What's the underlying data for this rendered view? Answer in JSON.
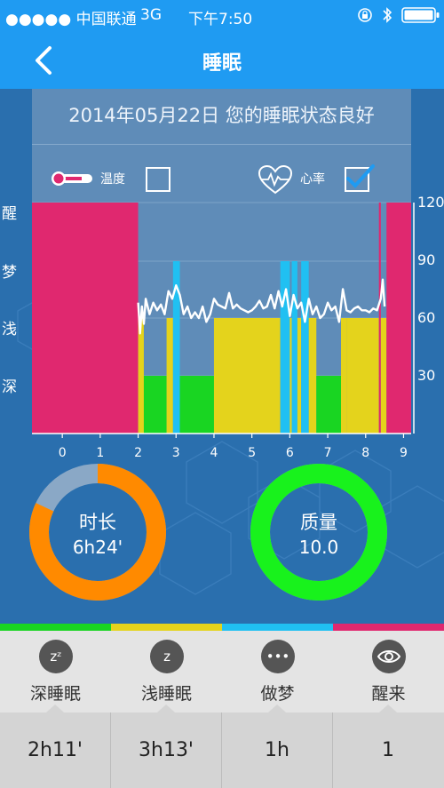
{
  "status": {
    "signal": "●●●●● 中国联通",
    "network": "3G",
    "time": "下午7:50"
  },
  "nav": {
    "title": "睡眠"
  },
  "header": {
    "date_line": "2014年05月22日 您的睡眠状态良好"
  },
  "options": {
    "temperature_label": "温度",
    "temperature_checked": false,
    "heartrate_label": "心率",
    "heartrate_checked": true
  },
  "chart_data": {
    "type": "bar",
    "stages": [
      "醒",
      "梦",
      "浅",
      "深"
    ],
    "x_ticks": [
      0,
      1,
      2,
      3,
      4,
      5,
      6,
      7,
      8,
      9
    ],
    "y_right_ticks": [
      120,
      90,
      60,
      30
    ],
    "xlim": [
      -0.8,
      9.2
    ],
    "stage_colors": {
      "醒": "#e0286f",
      "梦": "#20c0f2",
      "浅": "#e4d31c",
      "深": "#19d522"
    },
    "segments": [
      {
        "stage": "醒",
        "start": -0.8,
        "end": 2.0
      },
      {
        "stage": "浅",
        "start": 2.0,
        "end": 2.15
      },
      {
        "stage": "深",
        "start": 2.15,
        "end": 2.75
      },
      {
        "stage": "浅",
        "start": 2.75,
        "end": 2.92
      },
      {
        "stage": "梦",
        "start": 2.92,
        "end": 3.1
      },
      {
        "stage": "深",
        "start": 3.1,
        "end": 4.0
      },
      {
        "stage": "浅",
        "start": 4.0,
        "end": 5.75
      },
      {
        "stage": "梦",
        "start": 5.75,
        "end": 6.0
      },
      {
        "stage": "浅",
        "start": 6.0,
        "end": 6.05
      },
      {
        "stage": "梦",
        "start": 6.05,
        "end": 6.2
      },
      {
        "stage": "浅",
        "start": 6.2,
        "end": 6.3
      },
      {
        "stage": "梦",
        "start": 6.3,
        "end": 6.5
      },
      {
        "stage": "浅",
        "start": 6.5,
        "end": 6.7
      },
      {
        "stage": "深",
        "start": 6.7,
        "end": 7.35
      },
      {
        "stage": "浅",
        "start": 7.35,
        "end": 7.5
      },
      {
        "stage": "浅",
        "start": 7.5,
        "end": 8.35
      },
      {
        "stage": "醒",
        "start": 8.35,
        "end": 8.4
      },
      {
        "stage": "浅",
        "start": 8.4,
        "end": 8.55
      },
      {
        "stage": "醒",
        "start": 8.55,
        "end": 9.2
      }
    ],
    "heart_rate": {
      "x": [
        2.0,
        2.05,
        2.1,
        2.15,
        2.2,
        2.3,
        2.4,
        2.5,
        2.6,
        2.7,
        2.8,
        2.9,
        3.0,
        3.1,
        3.2,
        3.3,
        3.4,
        3.5,
        3.6,
        3.7,
        3.8,
        3.9,
        4.0,
        4.1,
        4.2,
        4.3,
        4.4,
        4.5,
        4.6,
        4.7,
        4.8,
        4.9,
        5.0,
        5.1,
        5.2,
        5.3,
        5.4,
        5.5,
        5.6,
        5.7,
        5.8,
        5.9,
        6.0,
        6.1,
        6.2,
        6.3,
        6.4,
        6.5,
        6.6,
        6.7,
        6.8,
        6.9,
        7.0,
        7.1,
        7.2,
        7.3,
        7.4,
        7.5,
        7.6,
        7.7,
        7.8,
        7.9,
        8.0,
        8.1,
        8.2,
        8.3,
        8.4,
        8.45,
        8.5
      ],
      "values": [
        68,
        52,
        66,
        57,
        70,
        62,
        68,
        64,
        67,
        62,
        74,
        70,
        77,
        72,
        62,
        66,
        60,
        63,
        60,
        66,
        58,
        62,
        70,
        67,
        66,
        65,
        73,
        65,
        67,
        65,
        64,
        63,
        64,
        66,
        69,
        65,
        66,
        72,
        65,
        74,
        66,
        75,
        61,
        72,
        65,
        68,
        58,
        70,
        62,
        66,
        60,
        62,
        68,
        64,
        66,
        58,
        75,
        64,
        63,
        65,
        66,
        64,
        64,
        63,
        65,
        64,
        70,
        80,
        66
      ]
    }
  },
  "summary": {
    "duration_label": "时长",
    "duration_value": "6h24'",
    "duration_fraction": 0.82,
    "quality_label": "质量",
    "quality_value": "10.0",
    "quality_fraction": 1.0
  },
  "tabs": [
    {
      "icon": "deep-sleep-zz-icon",
      "glyph": "zᶻ",
      "label": "深睡眠",
      "value": "2h11'",
      "color": "#19d522"
    },
    {
      "icon": "light-sleep-z-icon",
      "glyph": "z",
      "label": "浅睡眠",
      "value": "3h13'",
      "color": "#e4d31c"
    },
    {
      "icon": "dream-dots-icon",
      "glyph": "•••",
      "label": "做梦",
      "value": "1h",
      "color": "#20c0f2"
    },
    {
      "icon": "awake-eye-icon",
      "glyph": "",
      "label": "醒来",
      "value": "1",
      "color": "#e0286f"
    }
  ]
}
